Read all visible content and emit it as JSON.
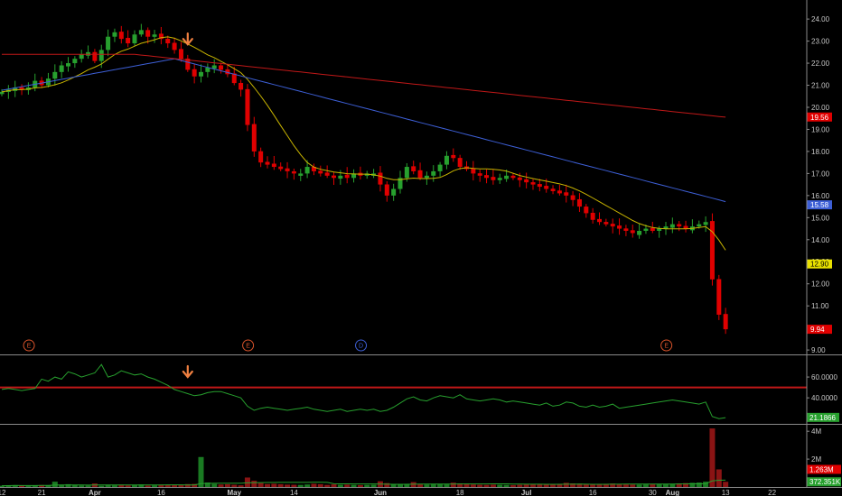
{
  "chart_data": [
    {
      "type": "candlestick",
      "panel": "price",
      "ylim": [
        8.8,
        24.7
      ],
      "y_ticks": [
        "24.00",
        "23.00",
        "22.00",
        "21.00",
        "20.00",
        "19.00",
        "18.00",
        "17.00",
        "16.00",
        "15.00",
        "14.00",
        "13.00",
        "12.00",
        "11.00",
        "10.00",
        "9.00"
      ],
      "x_ticks": [
        {
          "label": "12",
          "idx": 0,
          "month": false
        },
        {
          "label": "21",
          "idx": 6,
          "month": false
        },
        {
          "label": "Apr",
          "idx": 14,
          "month": true
        },
        {
          "label": "16",
          "idx": 24,
          "month": false
        },
        {
          "label": "May",
          "idx": 35,
          "month": true
        },
        {
          "label": "14",
          "idx": 44,
          "month": false
        },
        {
          "label": "Jun",
          "idx": 57,
          "month": true
        },
        {
          "label": "18",
          "idx": 69,
          "month": false
        },
        {
          "label": "Jul",
          "idx": 79,
          "month": true
        },
        {
          "label": "16",
          "idx": 89,
          "month": false
        },
        {
          "label": "30",
          "idx": 98,
          "month": false
        },
        {
          "label": "Aug",
          "idx": 101,
          "month": true
        },
        {
          "label": "13",
          "idx": 109,
          "month": false
        },
        {
          "label": "22",
          "idx": 116,
          "month": false
        }
      ],
      "closes": [
        20.7,
        20.8,
        20.9,
        20.8,
        20.9,
        21.2,
        21.0,
        21.3,
        21.6,
        21.9,
        22.0,
        22.2,
        22.4,
        22.5,
        22.1,
        22.6,
        23.2,
        23.4,
        23.1,
        22.9,
        23.3,
        23.5,
        23.2,
        23.3,
        23.1,
        22.9,
        22.6,
        22.2,
        21.7,
        21.4,
        21.6,
        21.8,
        21.9,
        21.7,
        21.5,
        21.1,
        20.8,
        19.2,
        18.0,
        17.5,
        17.4,
        17.3,
        17.2,
        17.1,
        17.0,
        17.0,
        17.3,
        17.1,
        17.0,
        16.9,
        16.8,
        16.9,
        16.8,
        17.0,
        16.9,
        17.0,
        17.0,
        16.5,
        16.0,
        16.3,
        16.8,
        17.3,
        17.1,
        16.8,
        16.9,
        17.1,
        17.4,
        17.8,
        17.7,
        17.3,
        17.2,
        17.0,
        16.9,
        16.8,
        16.7,
        16.8,
        16.9,
        16.8,
        16.7,
        16.6,
        16.5,
        16.4,
        16.3,
        16.2,
        16.1,
        16.0,
        15.8,
        15.5,
        15.2,
        14.9,
        14.8,
        14.7,
        14.6,
        14.5,
        14.4,
        14.3,
        14.4,
        14.5,
        14.4,
        14.5,
        14.6,
        14.7,
        14.6,
        14.5,
        14.6,
        14.7,
        14.8,
        12.2,
        10.6,
        9.94
      ],
      "sma_short_label": "",
      "sma_mid_label": "",
      "sma_long_label": "",
      "price_tags": [
        {
          "label": "19.56",
          "value": 19.56,
          "color": "#e00000"
        },
        {
          "label": "15.58",
          "value": 15.58,
          "color": "#3d5fd6"
        },
        {
          "label": "12.90",
          "value": 12.9,
          "color": "#e8e000"
        },
        {
          "label": "9.94",
          "value": 9.94,
          "color": "#e00000"
        }
      ],
      "events": [
        {
          "label": "E",
          "idx": 3,
          "color": "#d9532a"
        },
        {
          "label": "E",
          "idx": 36,
          "color": "#d9532a"
        },
        {
          "label": "D",
          "idx": 53,
          "color": "#3d5fd6"
        },
        {
          "label": "E",
          "idx": 99,
          "color": "#d9532a"
        }
      ]
    },
    {
      "type": "line",
      "panel": "indicator",
      "ylim": [
        15,
        80
      ],
      "y_ticks": [
        "60.0000",
        "40.0000"
      ],
      "ref_line": 50,
      "last_tag": {
        "label": "21.1866",
        "value": 21.1866
      },
      "values": [
        48,
        49,
        48,
        47,
        48,
        49,
        58,
        56,
        60,
        58,
        65,
        63,
        60,
        62,
        64,
        72,
        60,
        62,
        66,
        64,
        62,
        63,
        60,
        58,
        55,
        52,
        48,
        46,
        44,
        42,
        43,
        45,
        46,
        46,
        44,
        42,
        40,
        32,
        28,
        30,
        31,
        30,
        29,
        28,
        29,
        30,
        31,
        29,
        28,
        27,
        28,
        29,
        27,
        28,
        29,
        28,
        29,
        27,
        28,
        31,
        35,
        39,
        41,
        38,
        37,
        40,
        42,
        41,
        40,
        43,
        39,
        38,
        37,
        38,
        39,
        38,
        36,
        37,
        36,
        35,
        34,
        33,
        35,
        32,
        33,
        36,
        35,
        32,
        31,
        33,
        31,
        32,
        34,
        30,
        31,
        32,
        33,
        34,
        35,
        36,
        37,
        38,
        37,
        36,
        35,
        34,
        36,
        22,
        20,
        21
      ]
    },
    {
      "type": "bar",
      "panel": "volume",
      "ylim": [
        0,
        4400000
      ],
      "y_ticks": [
        "4M",
        "2M"
      ],
      "tags": [
        {
          "label": "1.263M",
          "value": 1263000,
          "color": "#e00000"
        },
        {
          "label": "372.351K",
          "value": 372351,
          "color": "#27a02e"
        }
      ],
      "values": [
        90000,
        110000,
        130000,
        95000,
        85000,
        100000,
        140000,
        120000,
        380000,
        150000,
        200000,
        130000,
        110000,
        100000,
        250000,
        90000,
        130000,
        120000,
        170000,
        110000,
        150000,
        180000,
        100000,
        120000,
        170000,
        160000,
        150000,
        140000,
        210000,
        220000,
        2150000,
        320000,
        220000,
        180000,
        200000,
        160000,
        120000,
        680000,
        450000,
        280000,
        210000,
        230000,
        200000,
        170000,
        160000,
        150000,
        180000,
        230000,
        200000,
        150000,
        190000,
        160000,
        170000,
        150000,
        140000,
        150000,
        160000,
        410000,
        280000,
        220000,
        200000,
        230000,
        350000,
        210000,
        180000,
        220000,
        200000,
        190000,
        310000,
        260000,
        240000,
        180000,
        160000,
        150000,
        170000,
        160000,
        150000,
        140000,
        160000,
        180000,
        190000,
        200000,
        180000,
        220000,
        230000,
        300000,
        260000,
        240000,
        210000,
        200000,
        190000,
        230000,
        250000,
        210000,
        190000,
        180000,
        170000,
        190000,
        200000,
        220000,
        210000,
        230000,
        260000,
        280000,
        300000,
        320000,
        380000,
        4200000,
        1263000,
        372351
      ]
    }
  ],
  "tags": {
    "rsi_cursor_arrow": "down-arrow-icon",
    "price_cursor_arrow": "down-arrow-icon"
  },
  "colors": {
    "up": "#27a02e",
    "down": "#e00000",
    "sma_short": "#c8b400",
    "sma_mid": "#3d5fd6",
    "sma_long": "#c01818",
    "indicator": "#27a02e",
    "ref_line": "#c01818",
    "arrow": "#f08040"
  }
}
